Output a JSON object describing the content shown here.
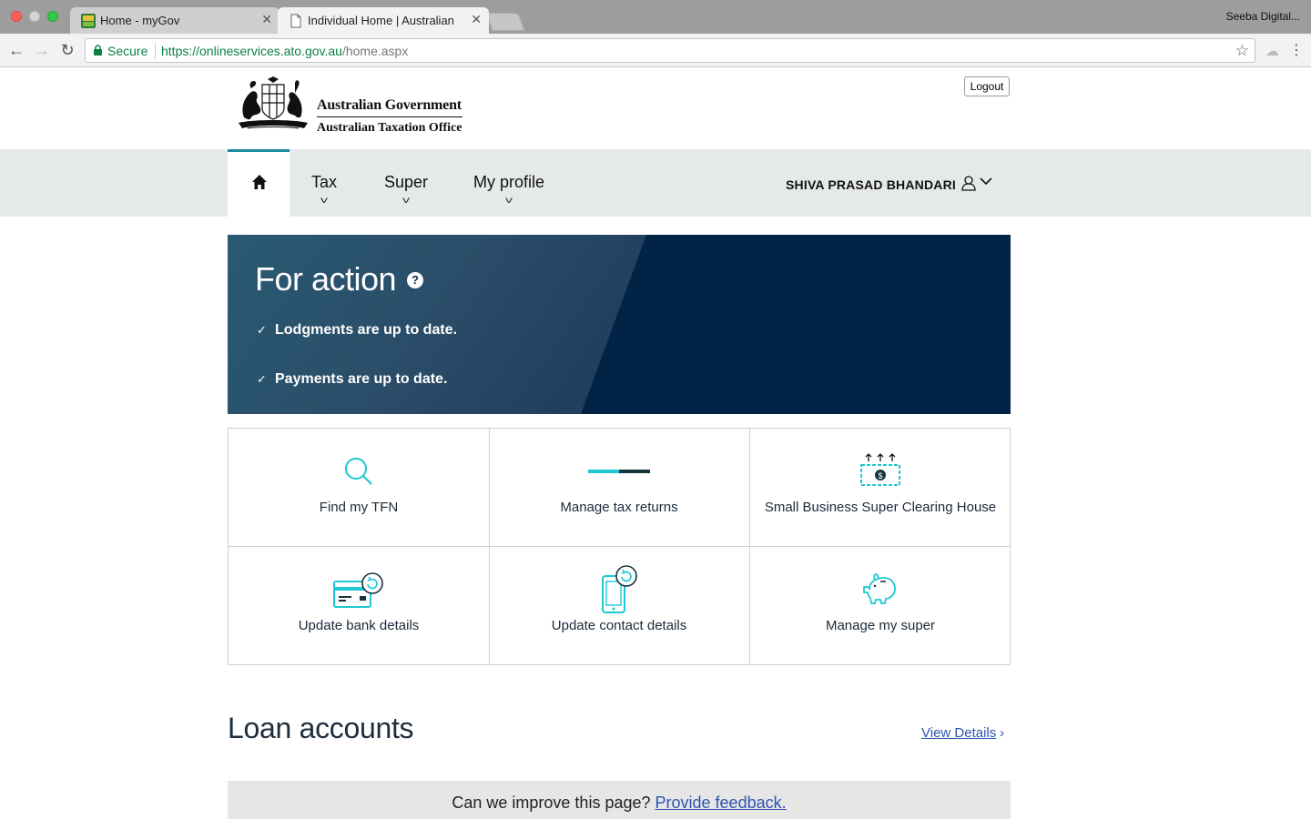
{
  "browser": {
    "tabs": [
      {
        "title": "Home - myGov",
        "active": false
      },
      {
        "title": "Individual Home | Australian Ta",
        "active": true
      }
    ],
    "profile_name": "Seeba Digital...",
    "secure_label": "Secure",
    "url_host": "https://onlineservices.ato.gov.au",
    "url_path": "/home.aspx"
  },
  "header": {
    "gov_name": "Australian Government",
    "agency_name": "Australian Taxation Office",
    "logout_label": "Logout"
  },
  "nav": {
    "items": [
      {
        "label": "Tax"
      },
      {
        "label": "Super"
      },
      {
        "label": "My profile"
      }
    ],
    "user_name": "SHIVA PRASAD BHANDARI",
    "accent_color": "#1b8a9a"
  },
  "for_action": {
    "title": "For action",
    "help_glyph": "?",
    "items": [
      "Lodgments are up to date.",
      "Payments are up to date."
    ]
  },
  "tiles": [
    {
      "label": "Find my TFN",
      "icon": "search-icon"
    },
    {
      "label": "Manage tax returns",
      "icon": "progress-bar-icon"
    },
    {
      "label": "Small Business Super Clearing House",
      "icon": "money-upload-icon"
    },
    {
      "label": "Update bank details",
      "icon": "card-refresh-icon"
    },
    {
      "label": "Update contact details",
      "icon": "phone-refresh-icon"
    },
    {
      "label": "Manage my super",
      "icon": "piggy-bank-icon"
    }
  ],
  "loan": {
    "title": "Loan accounts",
    "view_details": "View Details"
  },
  "feedback": {
    "question": "Can we improve this page?",
    "link": "Provide feedback."
  },
  "colors": {
    "icon_teal": "#1ec8d2",
    "banner_dark": "#012345",
    "link_blue": "#2e53b0"
  }
}
